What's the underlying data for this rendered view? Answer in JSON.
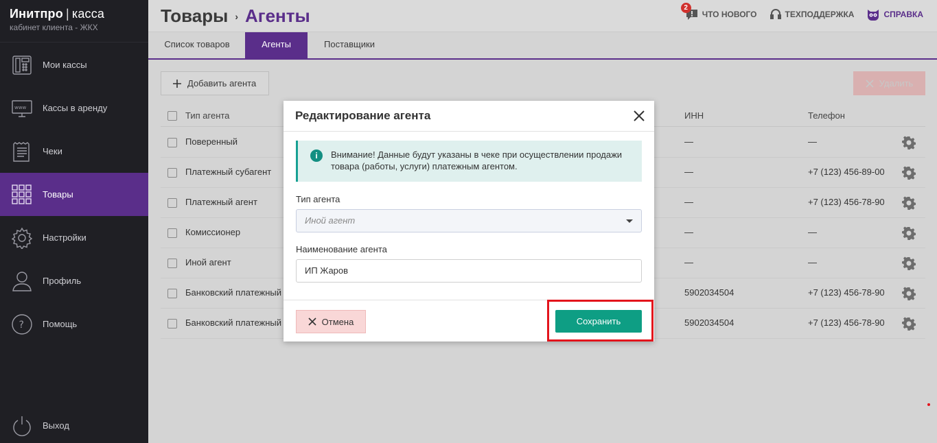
{
  "brand": {
    "name": "Инитпро",
    "separator": "|",
    "product": "касса",
    "subtitle": "кабинет клиента - ЖКХ"
  },
  "sidebar": {
    "items": [
      {
        "label": "Мои кассы",
        "icon": "cash-register-icon"
      },
      {
        "label": "Кассы в аренду",
        "icon": "www-monitor-icon"
      },
      {
        "label": "Чеки",
        "icon": "receipt-icon"
      },
      {
        "label": "Товары",
        "icon": "grid-icon",
        "active": true
      },
      {
        "label": "Настройки",
        "icon": "gear-icon"
      },
      {
        "label": "Профиль",
        "icon": "user-icon"
      },
      {
        "label": "Помощь",
        "icon": "help-icon"
      },
      {
        "label": "Выход",
        "icon": "power-icon"
      }
    ]
  },
  "header": {
    "breadcrumb_parent": "Товары",
    "breadcrumb_arrow": "›",
    "breadcrumb_current": "Агенты",
    "links": {
      "news": "ЧТО НОВОГО",
      "news_badge": "2",
      "support": "ТЕХПОДДЕРЖКА",
      "help": "СПРАВКА"
    }
  },
  "tabs": [
    {
      "label": "Список товаров"
    },
    {
      "label": "Агенты",
      "active": true
    },
    {
      "label": "Поставщики"
    }
  ],
  "toolbar": {
    "add_label": "Добавить агента",
    "delete_label": "Удалить"
  },
  "table": {
    "columns": {
      "type": "Тип агента",
      "inn": "ИНН",
      "phone": "Телефон"
    },
    "rows": [
      {
        "type": "Поверенный",
        "inn": "—",
        "phone": "—"
      },
      {
        "type": "Платежный субагент",
        "inn": "—",
        "phone": "+7 (123) 456-89-00"
      },
      {
        "type": "Платежный агент",
        "inn": "—",
        "phone": "+7 (123) 456-78-90"
      },
      {
        "type": "Комиссионер",
        "inn": "—",
        "phone": "—"
      },
      {
        "type": "Иной агент",
        "inn": "—",
        "phone": "—"
      },
      {
        "type": "Банковский платежный",
        "inn": "5902034504",
        "phone": "+7 (123) 456-78-90"
      },
      {
        "type": "Банковский платежный",
        "inn": "5902034504",
        "phone": "+7 (123) 456-78-90"
      }
    ]
  },
  "modal": {
    "title": "Редактирование агента",
    "alert_line1": "Внимание! Данные будут указаны в чеке при осуществлении продажи",
    "alert_line2": "товара (работы, услуги) платежным агентом.",
    "type_label": "Тип агента",
    "type_value": "Иной агент",
    "name_label": "Наименование агента",
    "name_value": "ИП Жаров",
    "cancel_label": "Отмена",
    "save_label": "Сохранить"
  },
  "colors": {
    "accent": "#5a2e8a",
    "save": "#0e9e84",
    "highlight": "#e3141c",
    "info": "#17a093"
  }
}
